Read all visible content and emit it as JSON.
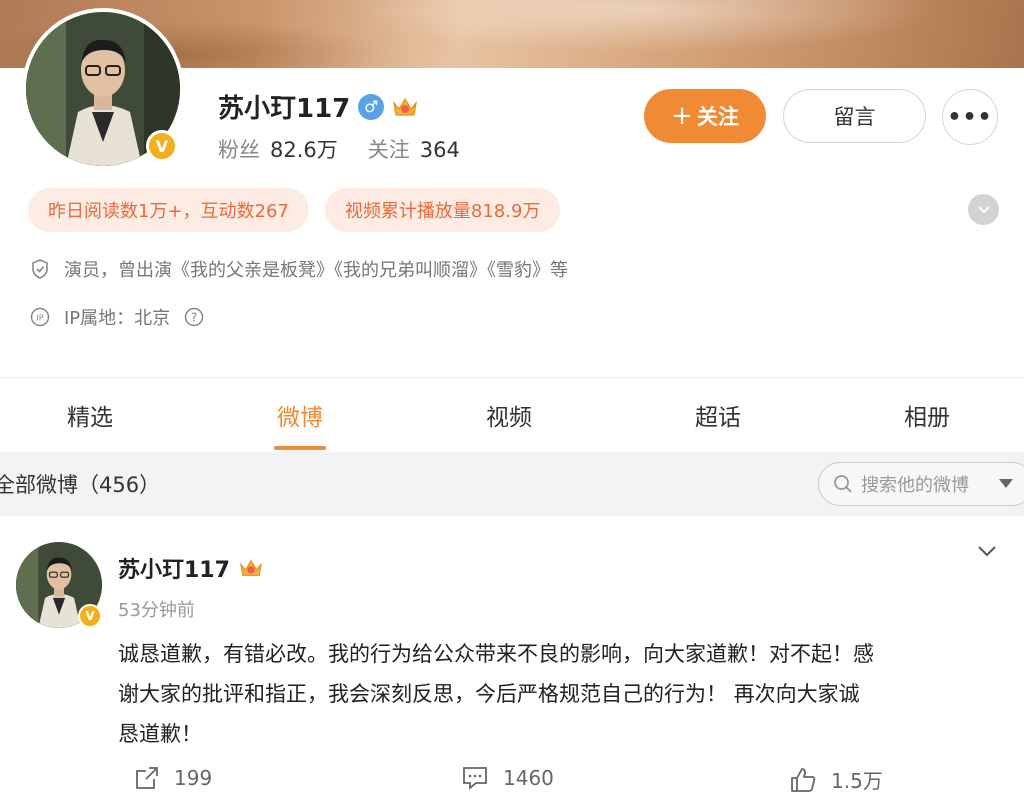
{
  "profile": {
    "name": "苏小玎117",
    "verified_badge": "V",
    "followers_label": "粉丝",
    "followers_value": "82.6万",
    "following_label": "关注",
    "following_value": "364"
  },
  "buttons": {
    "follow": "关注",
    "follow_plus": "+",
    "message": "留言",
    "more": "•••"
  },
  "tags": [
    "昨日阅读数1万+，互动数267",
    "视频累计播放量818.9万"
  ],
  "info": {
    "bio": "演员，曾出演《我的父亲是板凳》《我的兄弟叫顺溜》《雪豹》等",
    "ip": "IP属地：北京"
  },
  "tabs": [
    "精选",
    "微博",
    "视频",
    "超话",
    "相册"
  ],
  "active_tab": "微博",
  "filter": {
    "title": "全部微博（456）",
    "search_placeholder": "搜索他的微博"
  },
  "post": {
    "author": "苏小玎117",
    "time": "53分钟前",
    "line1": "诚恳道歉，有错必改。我的行为给公众带来不良的影响，向大家道歉！对不起！感",
    "line2": "谢大家的批评和指正，我会深刻反思，今后严格规范自己的行为！ 再次向大家诚",
    "line3": "恳道歉！",
    "reposts": "199",
    "comments": "1460",
    "likes": "1.5万"
  },
  "colors": {
    "accent": "#f08a35",
    "tag_text": "#ea6a3c",
    "tag_bg": "#fdece3",
    "verified": "#f2b01e",
    "male": "#5aa1e6"
  },
  "icons": [
    "male-icon",
    "crown-icon",
    "shield-icon",
    "ip-icon",
    "help-icon",
    "search-icon",
    "chevron-down-icon",
    "share-icon",
    "comment-icon",
    "like-icon"
  ]
}
